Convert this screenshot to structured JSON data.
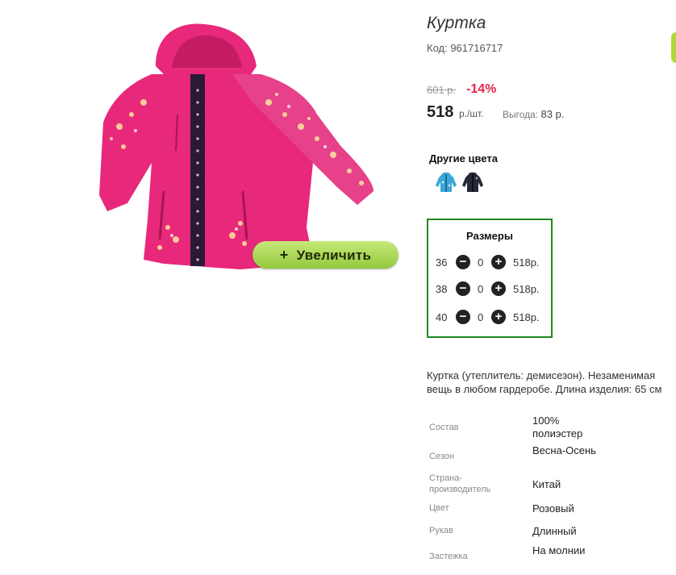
{
  "product": {
    "title": "Куртка",
    "code": "Код: 961716717",
    "old_price": "601 р.",
    "discount": "-14%",
    "price": "518",
    "price_unit": "р./шт.",
    "saving_label": "Выгода:",
    "saving_value": "83 р.",
    "zoom_label": "Увеличить",
    "zoom_plus": "+"
  },
  "colors": {
    "label": "Другие цвета",
    "items": [
      "blue-jacket",
      "dark-navy-jacket"
    ]
  },
  "sizes": {
    "title": "Размеры",
    "rows": [
      {
        "size": "36",
        "qty": "0",
        "price": "518р."
      },
      {
        "size": "38",
        "qty": "0",
        "price": "518р."
      },
      {
        "size": "40",
        "qty": "0",
        "price": "518р."
      }
    ],
    "minus_symbol": "−",
    "plus_symbol": "+"
  },
  "description": {
    "line1": "Куртка (утеплитель: демисезон). Незаменимая",
    "line2": "вещь в любом гардеробе. Длина изделия: 65 см"
  },
  "attributes": [
    {
      "label": "Состав",
      "value": "100% полиэстер"
    },
    {
      "label": "Сезон",
      "value": "Весна-Осень"
    },
    {
      "label": "Страна-производитель",
      "value": "Китай"
    },
    {
      "label": "Цвет",
      "value": "Розовый"
    },
    {
      "label": "Рукав",
      "value": "Длинный"
    },
    {
      "label": "Застежка",
      "value": "На молнии"
    }
  ],
  "theme": {
    "accent_green": "#1f8a1f",
    "button_green": "#a6d552",
    "discount_red": "#e1274a",
    "jacket_pink": "#e8287a"
  }
}
